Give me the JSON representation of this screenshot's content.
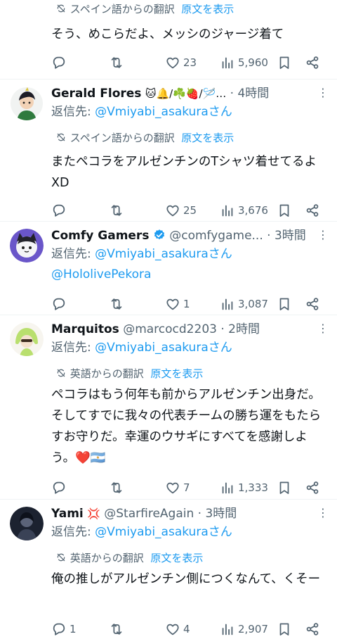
{
  "tweets": [
    {
      "translation_label": "スペイン語からの翻訳",
      "show_original": "原文を表示",
      "body": "そう、めこらだよ、メッシのジャージ着て",
      "stats": {
        "replies": "",
        "retweets": "",
        "likes": "23",
        "views": "5,960"
      }
    },
    {
      "name": "Gerald Flores",
      "name_emojis": "🐱🔔/☘️🍓/🪡…",
      "handle": "",
      "time": "4時間",
      "reply_prefix": "返信先: ",
      "reply_to": "@Vmiyabi_asakura",
      "reply_suffix": "さん",
      "translation_label": "スペイン語からの翻訳",
      "show_original": "原文を表示",
      "body": "またペコラをアルゼンチンのTシャツ着せてるよ XD",
      "stats": {
        "replies": "",
        "retweets": "",
        "likes": "25",
        "views": "3,676"
      }
    },
    {
      "name": "Comfy Gamers",
      "handle": "@comfygame...",
      "time": "3時間",
      "reply_prefix": "返信先: ",
      "reply_to": "@Vmiyabi_asakura",
      "reply_suffix": "さん",
      "reply_to_2": "@HololivePekora",
      "stats": {
        "replies": "",
        "retweets": "",
        "likes": "1",
        "views": "3,087"
      }
    },
    {
      "name": "Marquitos",
      "handle": "@marcocd2203",
      "time": "2時間",
      "reply_prefix": "返信先: ",
      "reply_to": "@Vmiyabi_asakura",
      "reply_suffix": "さん",
      "translation_label": "英語からの翻訳",
      "show_original": "原文を表示",
      "body": "ペコラはもう何年も前からアルゼンチン出身だ。そしてすでに我々の代表チームの勝ち運をもたらすお守りだ。幸運のウサギにすべてを感謝しよう。❤️🇦🇷",
      "stats": {
        "replies": "",
        "retweets": "",
        "likes": "7",
        "views": "1,333"
      }
    },
    {
      "name": "Yami",
      "name_emojis": "💢",
      "handle": "@StarfireAgain",
      "time": "3時間",
      "reply_prefix": "返信先: ",
      "reply_to": "@Vmiyabi_asakura",
      "reply_suffix": "さん",
      "translation_label": "英語からの翻訳",
      "show_original": "原文を表示",
      "body": "俺の推しがアルゼンチン側につくなんて、くそー",
      "stats": {
        "replies": "1",
        "retweets": "",
        "likes": "4",
        "views": "2,907"
      }
    }
  ],
  "colors": {
    "link": "#1d9bf0",
    "muted": "#536471",
    "text": "#0f1419",
    "verified": "#1d9bf0"
  },
  "icons": [
    "reply-icon",
    "retweet-icon",
    "like-icon",
    "views-icon",
    "bookmark-icon",
    "share-icon",
    "translate-icon",
    "more-icon",
    "verified-badge-icon"
  ]
}
